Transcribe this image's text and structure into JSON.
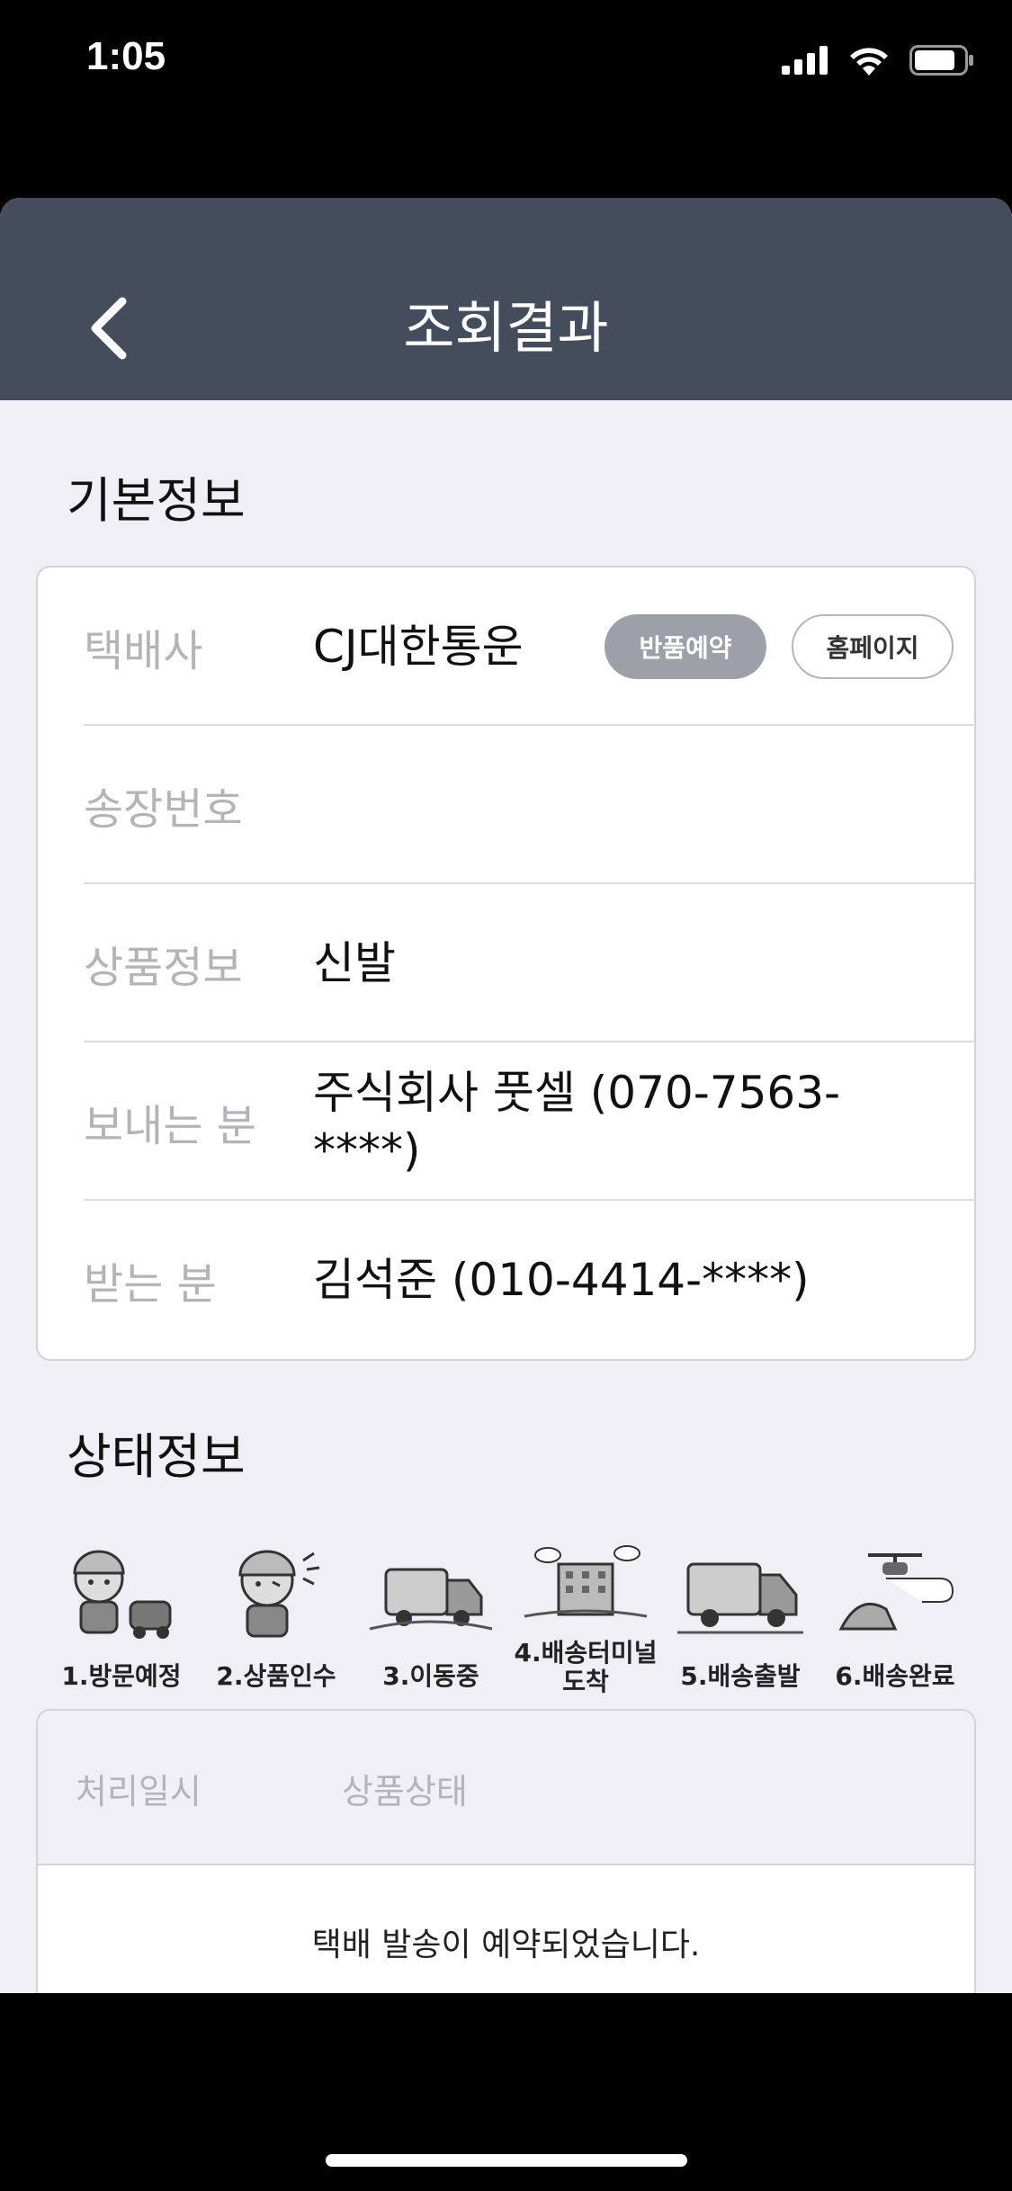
{
  "status_bar": {
    "time": "1:05"
  },
  "navbar": {
    "title": "조회결과"
  },
  "basic_info": {
    "title": "기본정보",
    "rows": [
      {
        "label": "택배사",
        "value": "CJ대한통운"
      },
      {
        "label": "송장번호",
        "value": ""
      },
      {
        "label": "상품정보",
        "value": "신발"
      },
      {
        "label": "보내는 분",
        "value": "주식회사 풋셀 (070-7563-****)"
      },
      {
        "label": "받는 분",
        "value": "김석준 (010-4414-****)"
      }
    ],
    "return_button": "반품예약",
    "homepage_button": "홈페이지"
  },
  "status_info": {
    "title": "상태정보",
    "steps": [
      {
        "label": "1.방문예정",
        "icon": "courier-visit-icon"
      },
      {
        "label": "2.상품인수",
        "icon": "courier-pickup-icon"
      },
      {
        "label": "3.이동중",
        "icon": "truck-moving-icon"
      },
      {
        "label": "4.배송터미널\n도착",
        "icon": "terminal-building-icon"
      },
      {
        "label": "5.배송출발",
        "icon": "truck-departure-icon"
      },
      {
        "label": "6.배송완료",
        "icon": "delivered-good-icon"
      }
    ],
    "history": {
      "col_time": "처리일시",
      "col_status": "상품상태",
      "message": "택배 발송이 예약되었습니다."
    }
  }
}
